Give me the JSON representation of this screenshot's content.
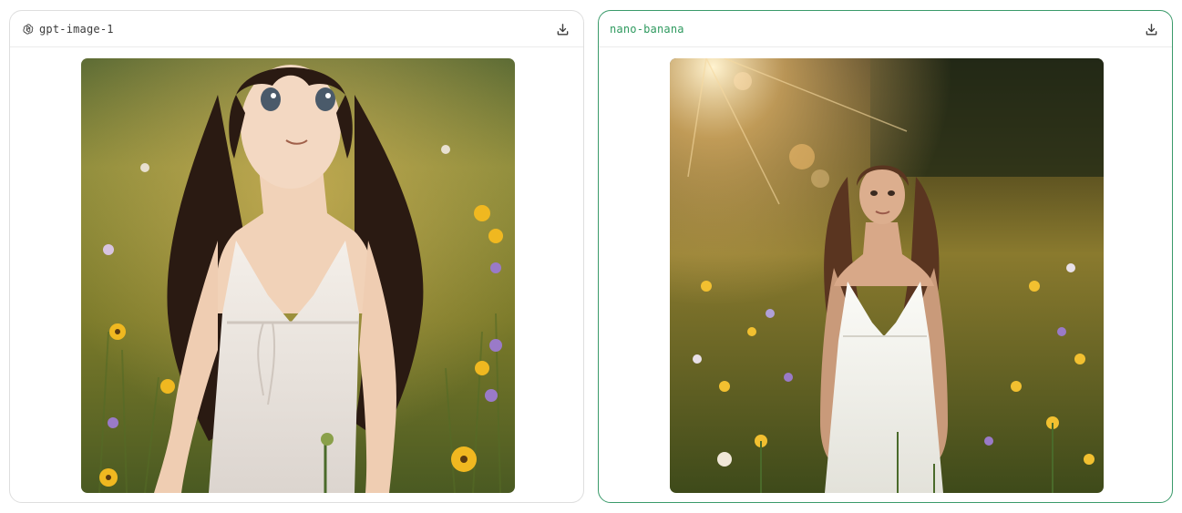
{
  "panels": [
    {
      "model_name": "gpt-image-1",
      "model_icon": "openai-logo-icon",
      "download_icon": "download-icon",
      "image_description": "anime-style girl with long dark hair in white sundress in a wildflower meadow"
    },
    {
      "model_name": "nano-banana",
      "download_icon": "download-icon",
      "image_description": "photorealistic woman with long brown hair in white sundress standing in a sunlit wildflower meadow"
    }
  ],
  "colors": {
    "selected_border": "#3a9a6a",
    "selected_text": "#2f9a5f",
    "default_border": "#dedede"
  }
}
